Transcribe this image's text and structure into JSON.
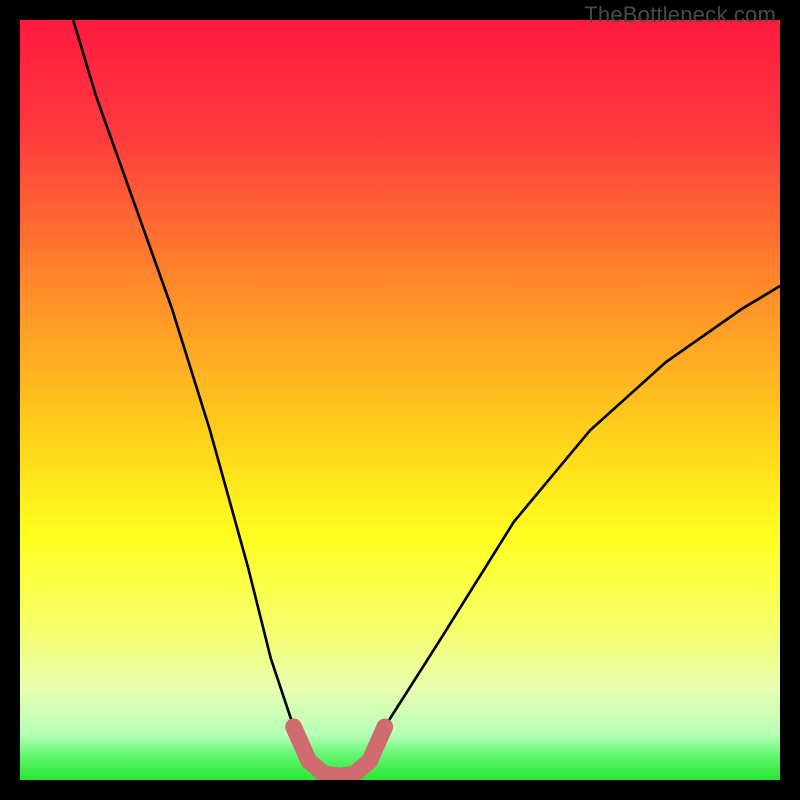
{
  "watermark": "TheBottleneck.com",
  "colors": {
    "frame": "#000000",
    "curve_black": "#000000",
    "curve_pink": "#cf6a6f",
    "green_band": "#27e833"
  },
  "chart_data": {
    "type": "line",
    "title": "",
    "xlabel": "",
    "ylabel": "",
    "xlim": [
      0,
      100
    ],
    "ylim": [
      0,
      100
    ],
    "note": "Axes are unlabeled; values below are estimated positions (0–100) inferred from the rendered curve shape, where y≈0 at the bottom and y≈100 at the top.",
    "series": [
      {
        "name": "bottleneck-curve",
        "x": [
          7,
          10,
          15,
          20,
          25,
          30,
          33,
          36,
          39,
          41,
          43,
          45,
          48,
          55,
          65,
          75,
          85,
          95,
          100
        ],
        "y": [
          100,
          90,
          76,
          62,
          46,
          28,
          16,
          7,
          2,
          0.5,
          0.5,
          2,
          7,
          18,
          34,
          46,
          55,
          62,
          65
        ]
      }
    ],
    "highlight_segment": {
      "name": "valley-highlight",
      "x": [
        36,
        38,
        40,
        42,
        44,
        46,
        48
      ],
      "y": [
        7,
        2.5,
        0.8,
        0.5,
        0.8,
        2.5,
        7
      ]
    },
    "background_gradient_stops": [
      {
        "pct": 0,
        "color": "#ff1a3f"
      },
      {
        "pct": 15,
        "color": "#ff3a3d"
      },
      {
        "pct": 35,
        "color": "#ff8a2a"
      },
      {
        "pct": 55,
        "color": "#ffd21a"
      },
      {
        "pct": 68,
        "color": "#ffff20"
      },
      {
        "pct": 80,
        "color": "#f5ff6a"
      },
      {
        "pct": 88,
        "color": "#e8ffb0"
      },
      {
        "pct": 94,
        "color": "#b6ffb6"
      },
      {
        "pct": 97,
        "color": "#5cf56a"
      },
      {
        "pct": 100,
        "color": "#27e833"
      }
    ]
  }
}
